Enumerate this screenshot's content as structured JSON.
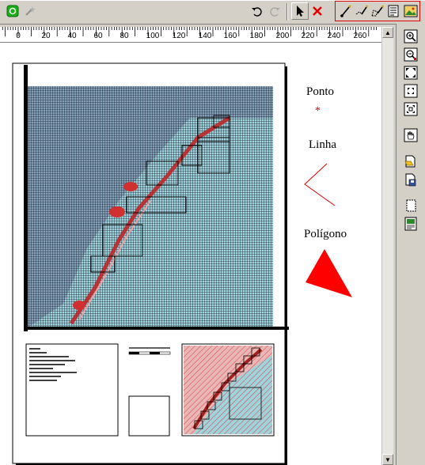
{
  "toolbar": {
    "buttons": [
      "green-app-icon",
      "wand-icon",
      "undo-icon",
      "redo-icon",
      "select-arrow-icon",
      "delete-x-icon"
    ],
    "draw_tools": [
      "draw-point-icon",
      "draw-line-icon",
      "draw-polygon-icon",
      "insert-text-icon",
      "insert-image-icon"
    ]
  },
  "ruler": {
    "ticks": [
      "0",
      "20",
      "40",
      "60",
      "80",
      "100",
      "120",
      "140",
      "160",
      "180",
      "200",
      "220",
      "240",
      "260"
    ]
  },
  "legend": {
    "point_label": "Ponto",
    "point_symbol": "*",
    "line_label": "Linha",
    "polygon_label": "Polígono"
  },
  "colors": {
    "accent_red": "#ff0000",
    "map_background": "#9fd4dc",
    "grid_dark": "#1a1a2a"
  },
  "right_toolbar": {
    "buttons": [
      "zoom-in-icon",
      "zoom-out-icon",
      "zoom-full-icon",
      "zoom-fit-icon",
      "zoom-selection-icon",
      "pan-hand-icon",
      "open-layout-icon",
      "save-layout-icon",
      "page-setup-icon",
      "print-preview-icon"
    ]
  }
}
